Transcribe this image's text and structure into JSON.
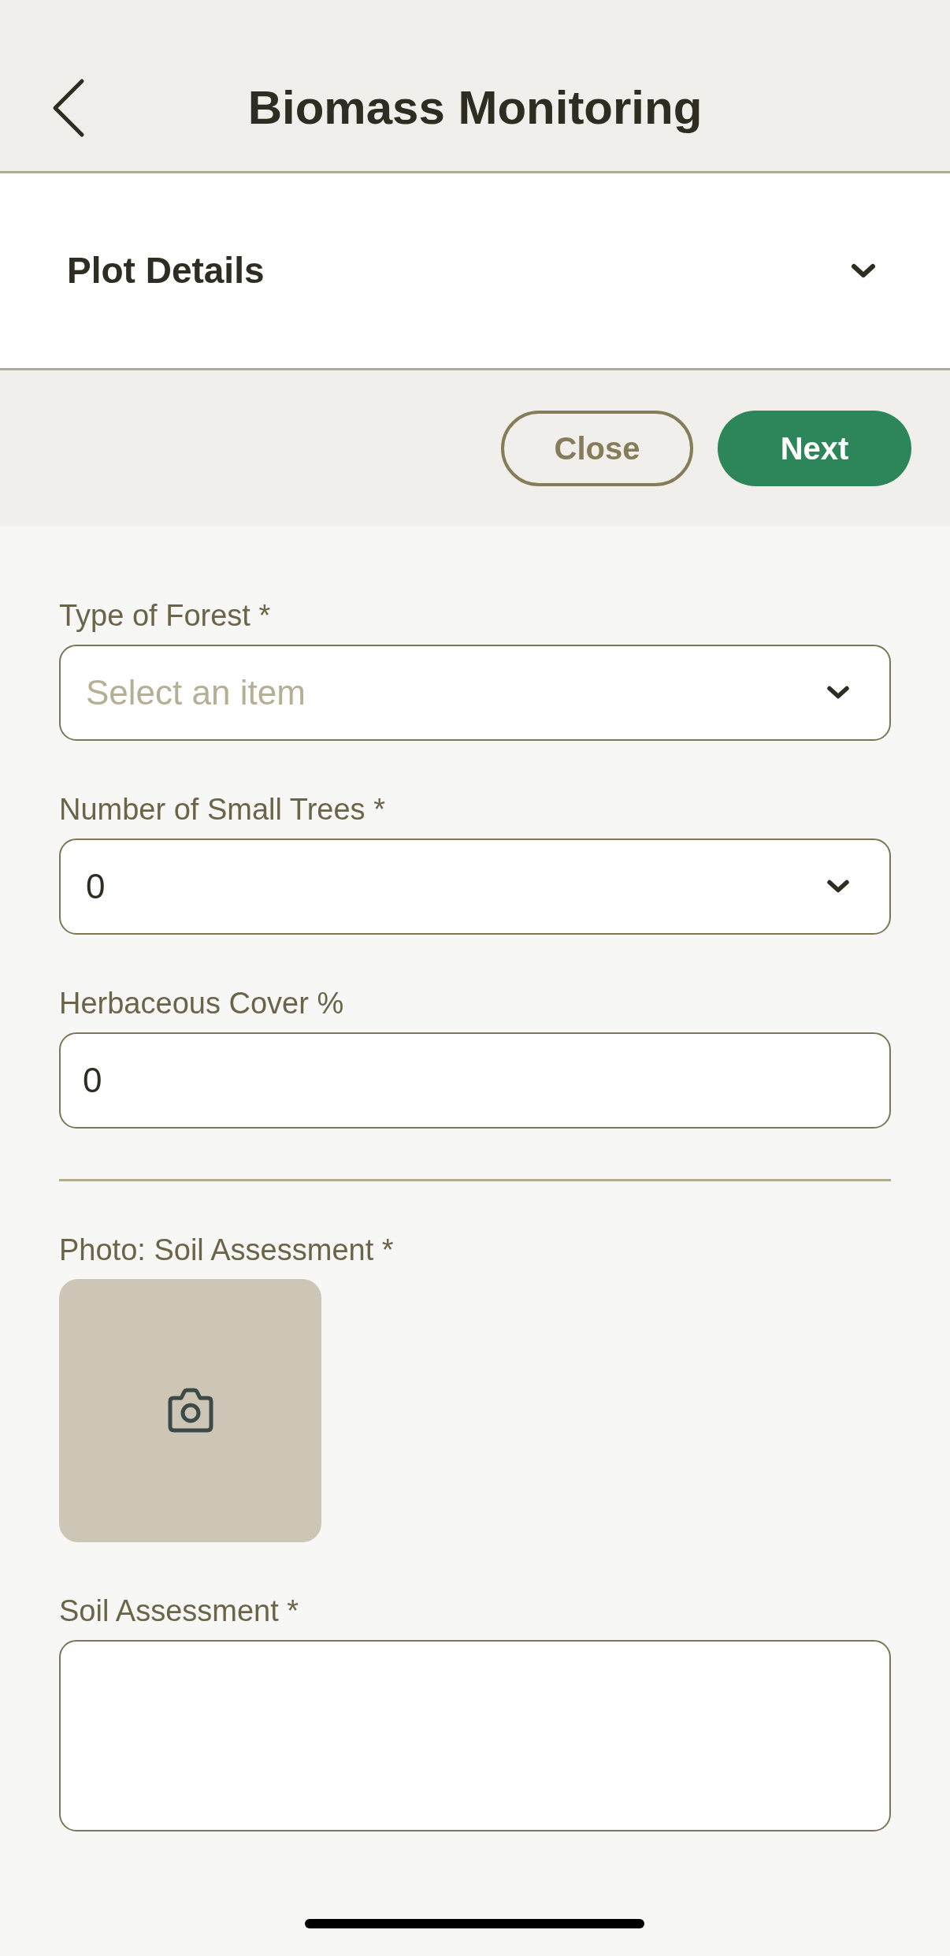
{
  "header": {
    "title": "Biomass Monitoring"
  },
  "section": {
    "title": "Plot Details",
    "expanded": false
  },
  "actions": [
    {
      "label": "Close",
      "kind": "secondary"
    },
    {
      "label": "Next",
      "kind": "primary"
    }
  ],
  "fields": [
    {
      "kind": "select",
      "label": "Type of Forest *",
      "placeholder": "Select an item"
    },
    {
      "kind": "select",
      "label": "Number of Small Trees *",
      "value": "0"
    },
    {
      "kind": "text",
      "label": "Herbaceous Cover %",
      "value": "0"
    },
    {
      "kind": "divider"
    },
    {
      "kind": "photo",
      "label": "Photo: Soil Assessment *"
    },
    {
      "kind": "textarea",
      "label": "Soil Assessment *"
    }
  ]
}
